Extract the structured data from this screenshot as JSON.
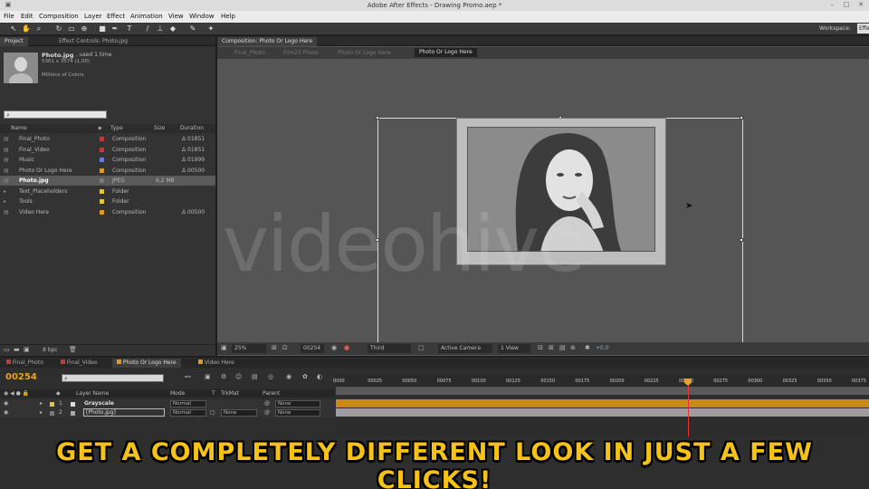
{
  "window": {
    "title": "Adobe After Effects - Drawing Promo.aep *"
  },
  "menu": [
    "File",
    "Edit",
    "Composition",
    "Layer",
    "Effect",
    "Animation",
    "View",
    "Window",
    "Help"
  ],
  "workspace": {
    "label": "Workspace:",
    "value": "Effe"
  },
  "project_panel": {
    "tabs": [
      "Project",
      "Effect Controls: Photo.jpg"
    ],
    "selected_file": "Photo.jpg",
    "used": ", used 1 time",
    "dimensions": "5361 x 3574 (1,00)",
    "colors": "Millions of Colors",
    "columns": {
      "name": "Name",
      "type": "Type",
      "size": "Size",
      "duration": "Duration"
    },
    "items": [
      {
        "name": "Final_Photo",
        "type": "Composition",
        "size": "",
        "duration": "Δ 01851",
        "color": "#c23a3a"
      },
      {
        "name": "Final_Video",
        "type": "Composition",
        "size": "",
        "duration": "Δ 01851",
        "color": "#c23a3a"
      },
      {
        "name": "Music",
        "type": "Composition",
        "size": "",
        "duration": "Δ 01999",
        "color": "#6a79d6"
      },
      {
        "name": "Photo Or Logo Here",
        "type": "Composition",
        "size": "",
        "duration": "Δ 00500",
        "color": "#e0962a"
      },
      {
        "name": "Photo.jpg",
        "type": "JPEG",
        "size": "6,2 MB",
        "duration": "",
        "color": "#7a7a7a"
      },
      {
        "name": "Text_Placeholders",
        "type": "Folder",
        "size": "",
        "duration": "",
        "color": "#e0c43a"
      },
      {
        "name": "Tools",
        "type": "Folder",
        "size": "",
        "duration": "",
        "color": "#e0c43a"
      },
      {
        "name": "Video Here",
        "type": "Composition",
        "size": "",
        "duration": "Δ 00500",
        "color": "#e0962a"
      }
    ],
    "bpc": "8 bpc"
  },
  "comp_panel": {
    "tab": "Composition: Photo Or Logo Here",
    "breadcrumbs": [
      "Final_Photo",
      "Film25 Photo",
      "Photo Or Logo Here",
      "Photo Or Logo Here"
    ],
    "watermark": "videohive",
    "viewer": {
      "zoom": "25%",
      "frame": "00254",
      "view": "Third",
      "camera": "Active Camera",
      "views": "1 View",
      "exposure": "+0,0"
    }
  },
  "timeline": {
    "tabs": [
      {
        "label": "Final_Photo",
        "color": "#c23a3a"
      },
      {
        "label": "Final_Video",
        "color": "#c23a3a"
      },
      {
        "label": "Photo Or Logo Here",
        "color": "#e0962a"
      },
      {
        "label": "Video Here",
        "color": "#e0962a"
      }
    ],
    "current_time": "00254",
    "headers": {
      "layer_name": "Layer Name",
      "mode": "Mode",
      "t": "T",
      "trkmat": "TrkMat",
      "parent": "Parent"
    },
    "ruler": [
      "0000",
      "00025",
      "00050",
      "00075",
      "00100",
      "00125",
      "00150",
      "00175",
      "00200",
      "00225",
      "00250",
      "00275",
      "00300",
      "00325",
      "00350",
      "00375"
    ],
    "layers": [
      {
        "num": "1",
        "name": "Grayscale",
        "mode": "Normal",
        "trkmat": "",
        "parent": "None"
      },
      {
        "num": "2",
        "name": "[Photo.jpg]",
        "mode": "Normal",
        "trkmat": "None",
        "parent": "None"
      }
    ]
  },
  "caption": "GET A COMPLETELY DIFFERENT LOOK IN JUST A FEW CLICKS!"
}
